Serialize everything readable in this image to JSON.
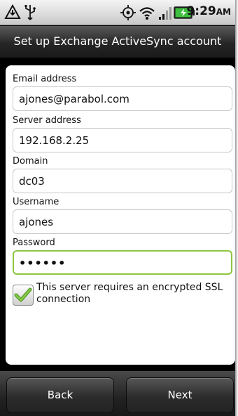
{
  "status_bar": {
    "time": "9:29",
    "ampm": "AM",
    "icons": [
      "airplane-notification-icon",
      "usb-icon",
      "gps-icon",
      "wifi-icon",
      "signal-icon",
      "battery-charging-icon"
    ]
  },
  "header": {
    "title": "Set up Exchange ActiveSync account"
  },
  "form": {
    "email_label": "Email address",
    "email_value": "ajones@parabol.com",
    "server_label": "Server address",
    "server_value": "192.168.2.25",
    "domain_label": "Domain",
    "domain_value": "dc03",
    "username_label": "Username",
    "username_value": "ajones",
    "password_label": "Password",
    "password_value": "••••••",
    "ssl_label": "This server requires an encrypted SSL connection",
    "ssl_checked": true
  },
  "footer": {
    "back_label": "Back",
    "next_label": "Next"
  },
  "colors": {
    "accent": "#8dc63f",
    "battery_green": "#3fbf3f"
  }
}
